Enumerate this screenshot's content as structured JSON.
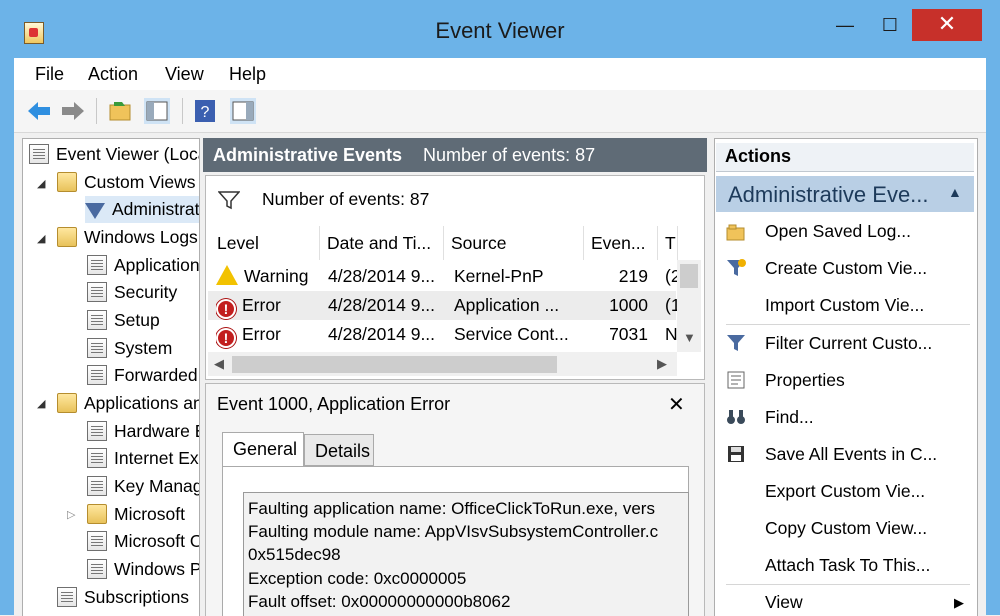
{
  "window": {
    "title": "Event Viewer",
    "min_glyph": "—",
    "max_glyph": "☐",
    "close_glyph": "✕"
  },
  "menu": [
    "File",
    "Action",
    "View",
    "Help"
  ],
  "toolbar": {
    "icons": [
      "back-arrow-icon",
      "forward-arrow-icon",
      "open-folder-icon",
      "show-hide-tree-icon",
      "help-icon",
      "show-hide-action-pane-icon"
    ]
  },
  "tree": {
    "root": "Event Viewer (Local)",
    "custom_views": "Custom Views",
    "administrative": "Administrative Events",
    "windows_logs": "Windows Logs",
    "windows_logs_items": [
      "Application",
      "Security",
      "Setup",
      "System",
      "Forwarded Events"
    ],
    "app_services": "Applications and Services Logs",
    "app_services_items": [
      "Hardware Events",
      "Internet Explorer",
      "Key Management Service",
      "Microsoft",
      "Microsoft Office Alerts",
      "Windows PowerShell"
    ],
    "subscriptions": "Subscriptions"
  },
  "center": {
    "header_title": "Administrative Events",
    "header_count": "Number of events: 87",
    "grid_count": "Number of events: 87",
    "columns": [
      "Level",
      "Date and Ti...",
      "Source",
      "Even...",
      "T"
    ],
    "rows": [
      {
        "level": "Warning",
        "date": "4/28/2014 9...",
        "source": "Kernel-PnP",
        "event": "219",
        "task": "(2"
      },
      {
        "level": "Error",
        "date": "4/28/2014 9...",
        "source": "Application ...",
        "event": "1000",
        "task": "(1"
      },
      {
        "level": "Error",
        "date": "4/28/2014 9...",
        "source": "Service Cont...",
        "event": "7031",
        "task": "N"
      }
    ]
  },
  "detail": {
    "title": "Event 1000, Application Error",
    "tabs": [
      "General",
      "Details"
    ],
    "lines": [
      "Faulting application name: OfficeClickToRun.exe, vers",
      "Faulting module name: AppVIsvSubsystemController.c",
      "0x515dec98",
      "Exception code: 0xc0000005",
      "Fault offset: 0x00000000000b8062"
    ]
  },
  "actions": {
    "title": "Actions",
    "section": "Administrative Eve...",
    "items": [
      {
        "label": "Open Saved Log...",
        "icon": "open-folder-icon"
      },
      {
        "label": "Create Custom Vie...",
        "icon": "create-filter-icon"
      },
      {
        "label": "Import Custom Vie...",
        "icon": ""
      },
      {
        "label": "Filter Current Custo...",
        "icon": "filter-icon"
      },
      {
        "label": "Properties",
        "icon": "properties-icon"
      },
      {
        "label": "Find...",
        "icon": "binoculars-icon"
      },
      {
        "label": "Save All Events in C...",
        "icon": "save-disk-icon"
      },
      {
        "label": "Export Custom Vie...",
        "icon": ""
      },
      {
        "label": "Copy Custom View...",
        "icon": ""
      },
      {
        "label": "Attach Task To This...",
        "icon": ""
      },
      {
        "label": "View",
        "icon": ""
      }
    ]
  }
}
